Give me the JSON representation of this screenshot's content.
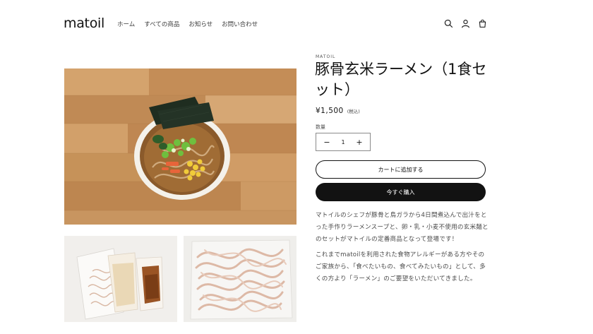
{
  "header": {
    "logo": "matoil",
    "nav": [
      "ホーム",
      "すべての商品",
      "お知らせ",
      "お問い合わせ"
    ],
    "icons": [
      "search-icon",
      "account-icon",
      "cart-icon"
    ]
  },
  "product": {
    "vendor": "MATOIL",
    "title": "豚骨玄米ラーメン（1食セット）",
    "price": "¥1,500",
    "tax_note": "(税込)",
    "quantity_label": "数量",
    "quantity_value": "1",
    "decrement": "−",
    "increment": "+",
    "add_to_cart": "カートに追加する",
    "buy_now": "今すぐ購入",
    "description": [
      "マトイルのシェフが豚骨と鳥ガラから4日間煮込んで出汁をとった手作りラーメンスープと、卵・乳・小麦不使用の玄米麺とのセットがマトイルの定番商品となって登場です！",
      "これまでmatoilを利用された食物アレルギーがある方やそのご家族から、「食べたいもの、食べてみたいもの」として、多くの方より「ラーメン」のご要望をいただいてきました。"
    ]
  },
  "colors": {
    "text": "#121212",
    "button_dark": "#121212",
    "wood": "#c9955f"
  }
}
